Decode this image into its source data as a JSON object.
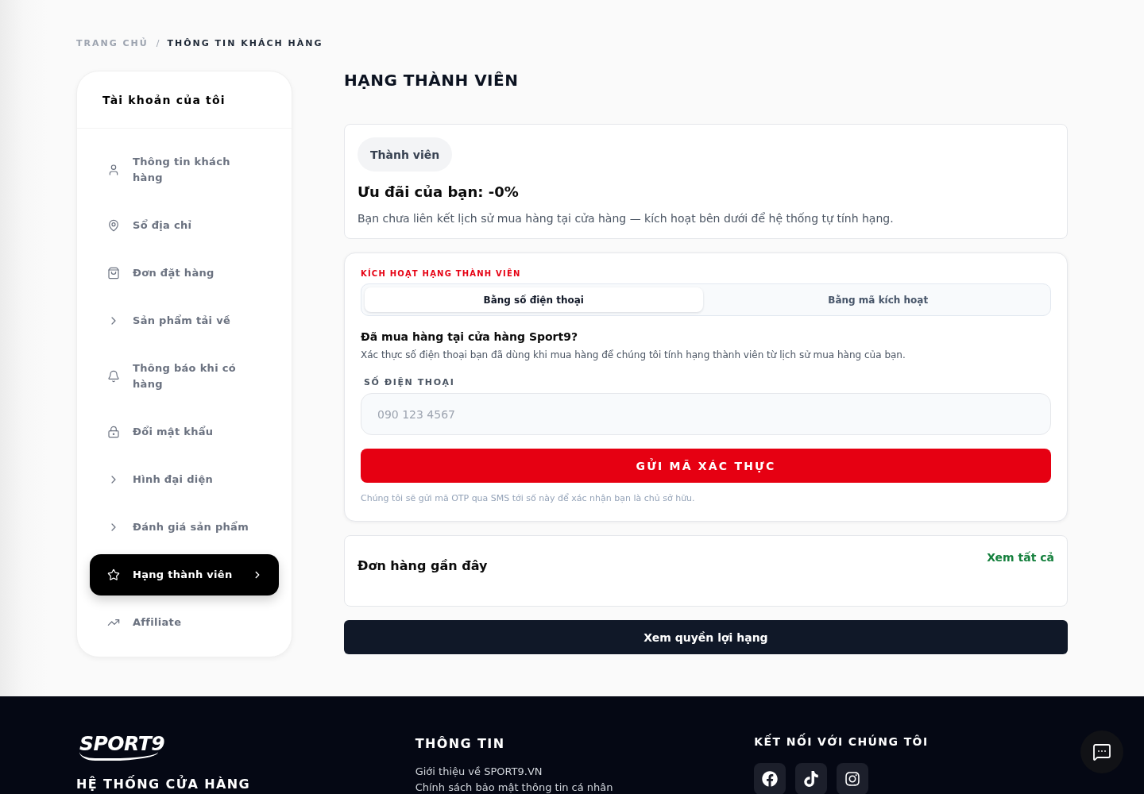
{
  "breadcrumb": {
    "items": [
      {
        "label": "TRANG CHỦ",
        "current": false
      },
      {
        "label": "THÔNG TIN KHÁCH HÀNG",
        "current": true
      }
    ],
    "separator": "/"
  },
  "sidebar": {
    "title": "Tài khoản của tôi",
    "items": [
      {
        "label": "Thông tin khách hàng",
        "selected": false
      },
      {
        "label": "Sổ địa chỉ",
        "selected": false
      },
      {
        "label": "Đơn đặt hàng",
        "selected": false
      },
      {
        "label": "Sản phẩm tải về",
        "selected": false
      },
      {
        "label": "Thông báo khi có hàng",
        "selected": false
      },
      {
        "label": "Đổi mật khẩu",
        "selected": false
      },
      {
        "label": "Hình đại diện",
        "selected": false
      },
      {
        "label": "Đánh giá sản phẩm",
        "selected": false
      },
      {
        "label": "Hạng thành viên",
        "selected": true
      },
      {
        "label": "Affiliate",
        "selected": false
      }
    ]
  },
  "page_title": "HẠNG THÀNH VIÊN",
  "tier_card": {
    "badge": "Thành viên",
    "discount": "Ưu đãi của bạn: -0%",
    "description": "Bạn chưa liên kết lịch sử mua hàng tại cửa hàng — kích hoạt bên dưới để hệ thống tự tính hạng."
  },
  "activation_card": {
    "label": "KÍCH HOẠT HẠNG THÀNH VIÊN",
    "tabs": [
      {
        "label": "Bằng số điện thoại",
        "selected": true
      },
      {
        "label": "Bằng mã kích hoạt",
        "selected": false
      }
    ],
    "heading": "Đã mua hàng tại cửa hàng Sport9?",
    "description": "Xác thực số điện thoại bạn đã dùng khi mua hàng để chúng tôi tính hạng thành viên từ lịch sử mua hàng của bạn.",
    "phone_field": {
      "label": "SỐ ĐIỆN THOẠI",
      "placeholder": "090 123 4567"
    },
    "submit_button": "GỬI MÃ XÁC THỰC",
    "note": "Chúng tôi sẽ gửi mã OTP qua SMS tới số này để xác nhận bạn là chủ sở hữu."
  },
  "recent_orders": {
    "title": "Đơn hàng gần đây",
    "view_all": "Xem tất cả"
  },
  "benefits_button": "Xem quyền lợi hạng",
  "footer": {
    "logo": "SPORT9",
    "stores_title": "HỆ THỐNG CỬA HÀNG",
    "info": {
      "title": "THÔNG TIN",
      "links": [
        "Giới thiệu về SPORT9.VN",
        "Chính sách bảo mật thông tin cá nhân"
      ]
    },
    "connect": {
      "title": "KẾT NỐI VỚI CHÚNG TÔI"
    }
  }
}
